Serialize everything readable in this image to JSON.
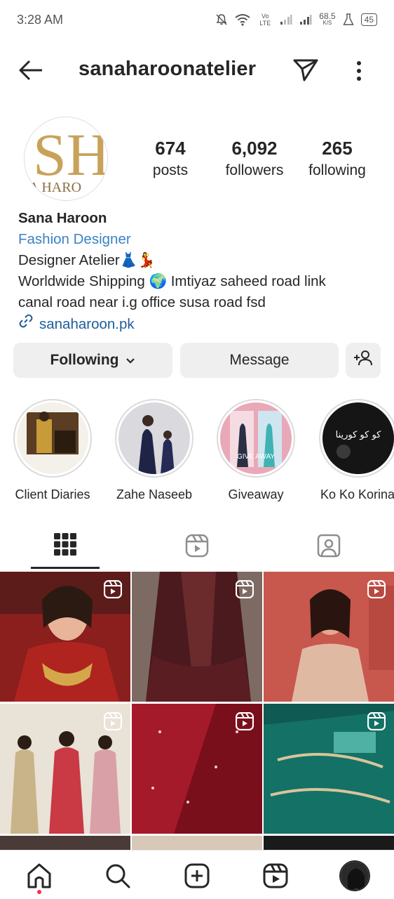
{
  "status_bar": {
    "time": "3:28 AM",
    "net_speed_value": "68.5",
    "net_speed_unit": "K/S",
    "battery": "45",
    "network_label": "Vo LTE"
  },
  "header": {
    "username": "sanaharoonatelier",
    "icons": [
      "back-arrow-icon",
      "send-icon",
      "more-icon"
    ]
  },
  "profile": {
    "avatar_text": "SH",
    "avatar_subtext": "A HARO",
    "stats": {
      "posts": {
        "value": "674",
        "label": "posts"
      },
      "followers": {
        "value": "6,092",
        "label": "followers"
      },
      "following": {
        "value": "265",
        "label": "following"
      }
    },
    "name": "Sana Haroon",
    "category": "Fashion Designer",
    "bio_lines": [
      "Designer Atelier👗💃",
      "Worldwide Shipping 🌍 Imtiyaz saheed road link",
      "canal road near i.g office susa road fsd"
    ],
    "website": "sanaharoon.pk"
  },
  "actions": {
    "following_label": "Following",
    "message_label": "Message"
  },
  "highlights": [
    {
      "label": "Client Diaries"
    },
    {
      "label": "Zahe Naseeb"
    },
    {
      "label": "Giveaway",
      "overlay_text": "GIVE AWAY"
    },
    {
      "label": "Ko Ko Korina",
      "overlay_text": "کو کو کورینا"
    }
  ],
  "tabs": [
    "grid",
    "reels",
    "tagged"
  ],
  "posts": [
    {
      "type": "reel"
    },
    {
      "type": "reel"
    },
    {
      "type": "reel"
    },
    {
      "type": "reel"
    },
    {
      "type": "reel"
    },
    {
      "type": "reel"
    }
  ],
  "bottom_nav": [
    "home",
    "search",
    "create",
    "reels",
    "profile"
  ],
  "colors": {
    "link_blue": "#1e5d9b",
    "category_blue": "#3b82c4",
    "button_bg": "#efefef",
    "notification_dot": "#ff3040",
    "avatar_gold": "#c9a25a"
  }
}
